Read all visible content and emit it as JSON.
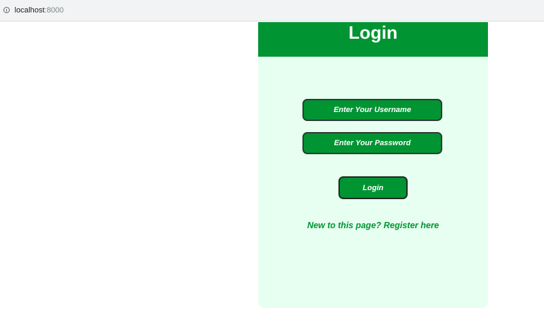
{
  "browser": {
    "url_host": "localhost",
    "url_port": ":8000",
    "icon": "info-icon"
  },
  "login_panel": {
    "title": "Login",
    "username_placeholder": "Enter Your Username",
    "username_value": "",
    "password_placeholder": "Enter Your Password",
    "password_value": "",
    "login_button_label": "Login",
    "register_link_text": "New to this page? Register here"
  },
  "colors": {
    "accent": "#009432",
    "panel_background": "#e6fff0",
    "header_text": "#ffffff"
  }
}
